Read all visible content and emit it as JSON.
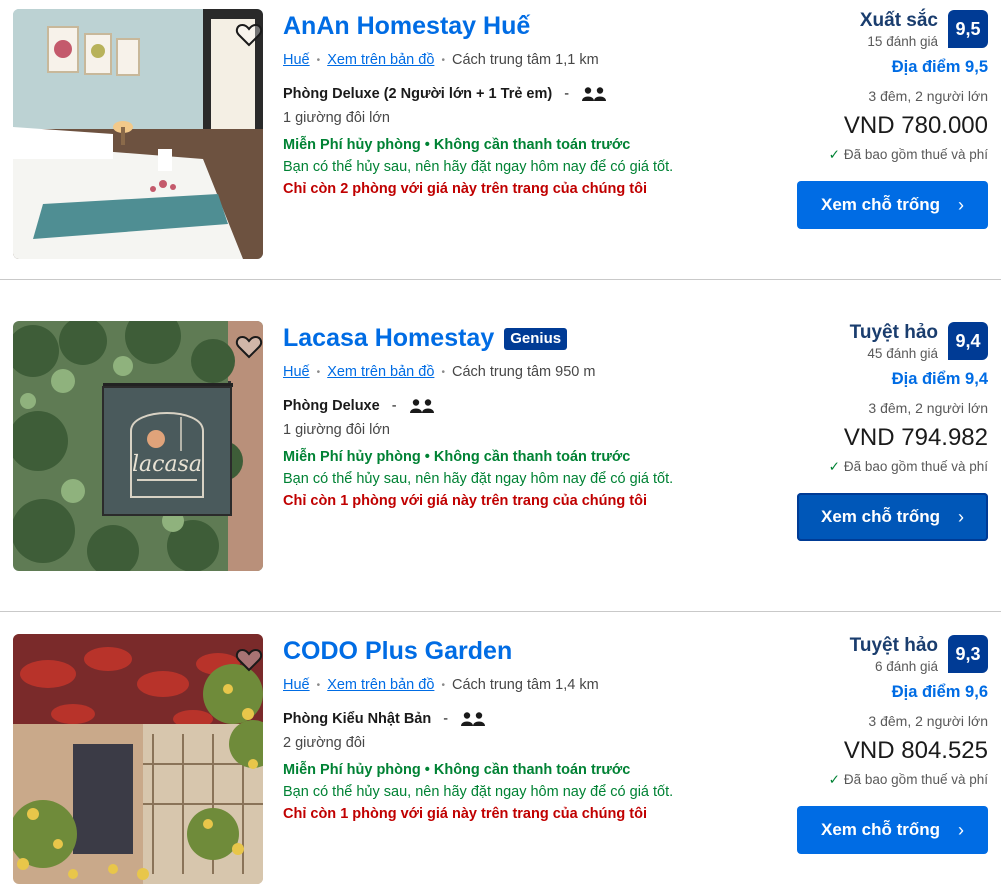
{
  "common": {
    "map_link": "Xem trên bản đồ",
    "dot": "•",
    "dash": "-",
    "taxes": "Đã bao gồm thuế và phí",
    "cta": "Xem chỗ trống",
    "chevron": "›",
    "check": "✓",
    "free_cancel": "Miễn Phí hủy phòng • Không cần thanh toán trước",
    "cancel_note": "Bạn có thể hủy sau, nên hãy đặt ngay hôm nay để có giá tốt.",
    "stay": "3 đêm, 2 người lớn"
  },
  "listings": [
    {
      "name": "AnAn Homestay Huế",
      "genius": "",
      "city": "Huế",
      "distance": "Cách trung tâm 1,1 km",
      "room": "Phòng Deluxe (2 Người lớn + 1 Trẻ em)",
      "bed": "1 giường đôi lớn",
      "scarcity": "Chỉ còn 2 phòng với giá này trên trang của chúng tôi",
      "rating_word": "Xuất sắc",
      "reviews": "15 đánh giá",
      "score": "9,5",
      "location_score": "Địa điểm 9,5",
      "price": "VND 780.000"
    },
    {
      "name": "Lacasa Homestay",
      "genius": "Genius",
      "city": "Huế",
      "distance": "Cách trung tâm 950 m",
      "room": "Phòng Deluxe",
      "bed": "1 giường đôi lớn",
      "scarcity": "Chỉ còn 1 phòng với giá này trên trang của chúng tôi",
      "rating_word": "Tuyệt hảo",
      "reviews": "45 đánh giá",
      "score": "9,4",
      "location_score": "Địa điểm 9,4",
      "price": "VND 794.982"
    },
    {
      "name": "CODO Plus Garden",
      "genius": "",
      "city": "Huế",
      "distance": "Cách trung tâm 1,4 km",
      "room": "Phòng Kiểu Nhật Bản",
      "bed": "2 giường đôi",
      "scarcity": "Chỉ còn 1 phòng với giá này trên trang của chúng tôi",
      "rating_word": "Tuyệt hảo",
      "reviews": "6 đánh giá",
      "score": "9,3",
      "location_score": "Địa điểm 9,6",
      "price": "VND 804.525"
    }
  ],
  "photo_logo_text": "lacasa"
}
